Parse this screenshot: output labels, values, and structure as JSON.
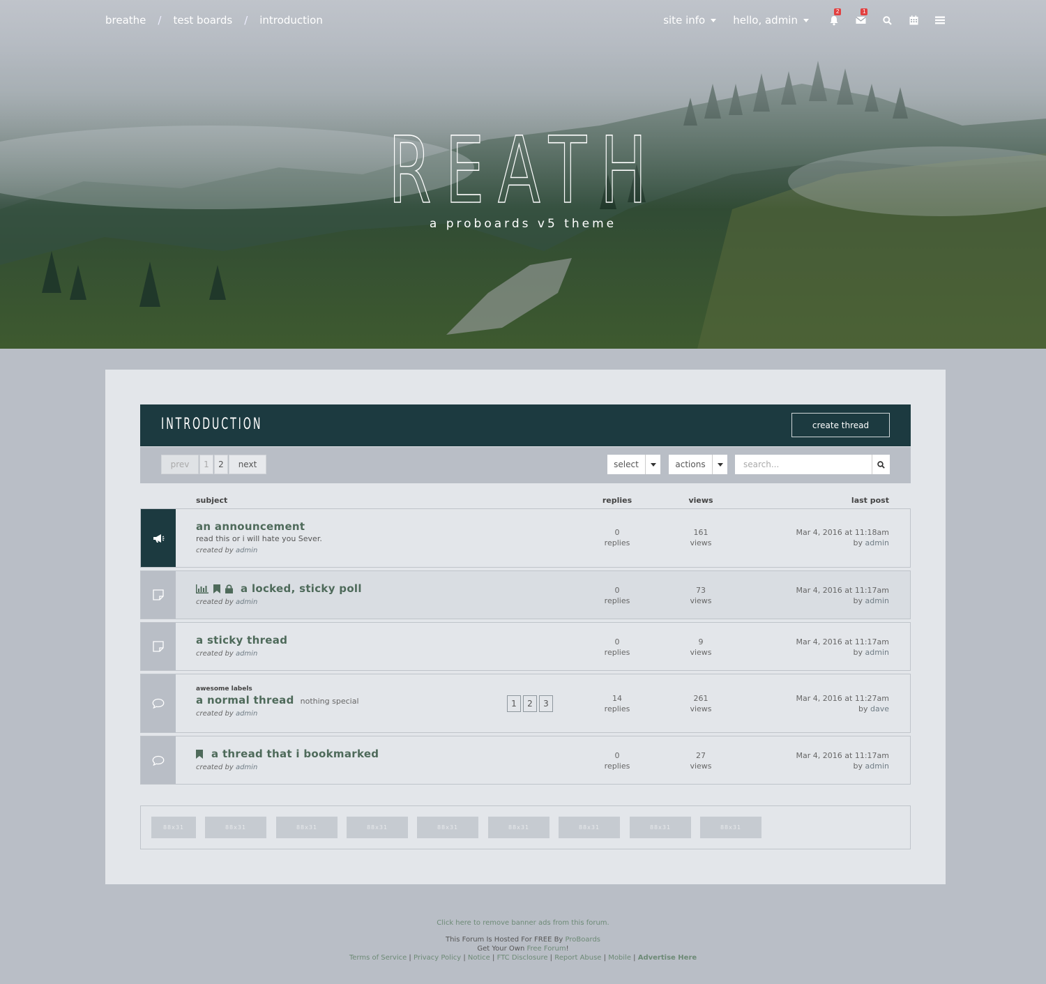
{
  "breadcrumb": [
    "breathe",
    "test boards",
    "introduction"
  ],
  "breadcrumb_sep": "/",
  "nav": {
    "site_info": "site info",
    "hello": "hello, admin",
    "notifications_count": "2",
    "messages_count": "1"
  },
  "icons": [
    "bell-icon",
    "envelope-icon",
    "search-icon",
    "calendar-icon",
    "menu-icon"
  ],
  "hero": {
    "title": "BREATHE",
    "subtitle": "a proboards v5 theme"
  },
  "board": {
    "title": "INTRODUCTION",
    "create_thread": "create thread"
  },
  "controls": {
    "prev": "prev",
    "pages": [
      "1",
      "2"
    ],
    "next": "next",
    "select": "select",
    "actions": "actions",
    "search_placeholder": "search..."
  },
  "columns": {
    "subject": "subject",
    "replies": "replies",
    "views": "views",
    "last_post": "last post"
  },
  "threads": [
    {
      "title": "an announcement",
      "description": "read this or i will hate you Sever.",
      "created_prefix": "created by",
      "creator": "admin",
      "replies": "0",
      "replies_label": "replies",
      "views": "161",
      "views_label": "views",
      "last_post_date": "Mar 4, 2016 at 11:18am",
      "last_post_by": "by",
      "last_post_user": "admin"
    },
    {
      "title": "a locked, sticky poll",
      "created_prefix": "created by",
      "creator": "admin",
      "replies": "0",
      "replies_label": "replies",
      "views": "73",
      "views_label": "views",
      "last_post_date": "Mar 4, 2016 at 11:17am",
      "last_post_by": "by",
      "last_post_user": "admin"
    },
    {
      "title": "a sticky thread",
      "created_prefix": "created by",
      "creator": "admin",
      "replies": "0",
      "replies_label": "replies",
      "views": "9",
      "views_label": "views",
      "last_post_date": "Mar 4, 2016 at 11:17am",
      "last_post_by": "by",
      "last_post_user": "admin"
    },
    {
      "labels": "awesome  labels",
      "title": "a normal thread",
      "description": "nothing special",
      "created_prefix": "created by",
      "creator": "admin",
      "pages": [
        "1",
        "2",
        "3"
      ],
      "replies": "14",
      "replies_label": "replies",
      "views": "261",
      "views_label": "views",
      "last_post_date": "Mar 4, 2016 at 11:27am",
      "last_post_by": "by",
      "last_post_user": "dave"
    },
    {
      "title": "a thread that i bookmarked",
      "created_prefix": "created by",
      "creator": "admin",
      "replies": "0",
      "replies_label": "replies",
      "views": "27",
      "views_label": "views",
      "last_post_date": "Mar 4, 2016 at 11:17am",
      "last_post_by": "by",
      "last_post_user": "admin"
    }
  ],
  "ads": [
    "88x31",
    "88x31",
    "88x31",
    "88x31",
    "88x31",
    "88x31",
    "88x31",
    "88x31",
    "88x31"
  ],
  "footer": {
    "remove_ads": "Click here to remove banner ads from this forum.",
    "hosted_prefix": "This Forum Is Hosted For FREE By",
    "hosted_link": "ProBoards",
    "get_prefix": "Get Your Own",
    "get_link": "Free Forum",
    "get_suffix": "!",
    "links": [
      "Terms of Service",
      "Privacy Policy",
      "Notice",
      "FTC Disclosure",
      "Report Abuse",
      "Mobile"
    ],
    "advertise": "Advertise Here"
  },
  "colors": {
    "accent": "#1c3a40",
    "link_green": "#4e6a5a",
    "badge_red": "#e24040",
    "page_bg": "#b9bec6",
    "card_bg": "#e3e6ea"
  }
}
